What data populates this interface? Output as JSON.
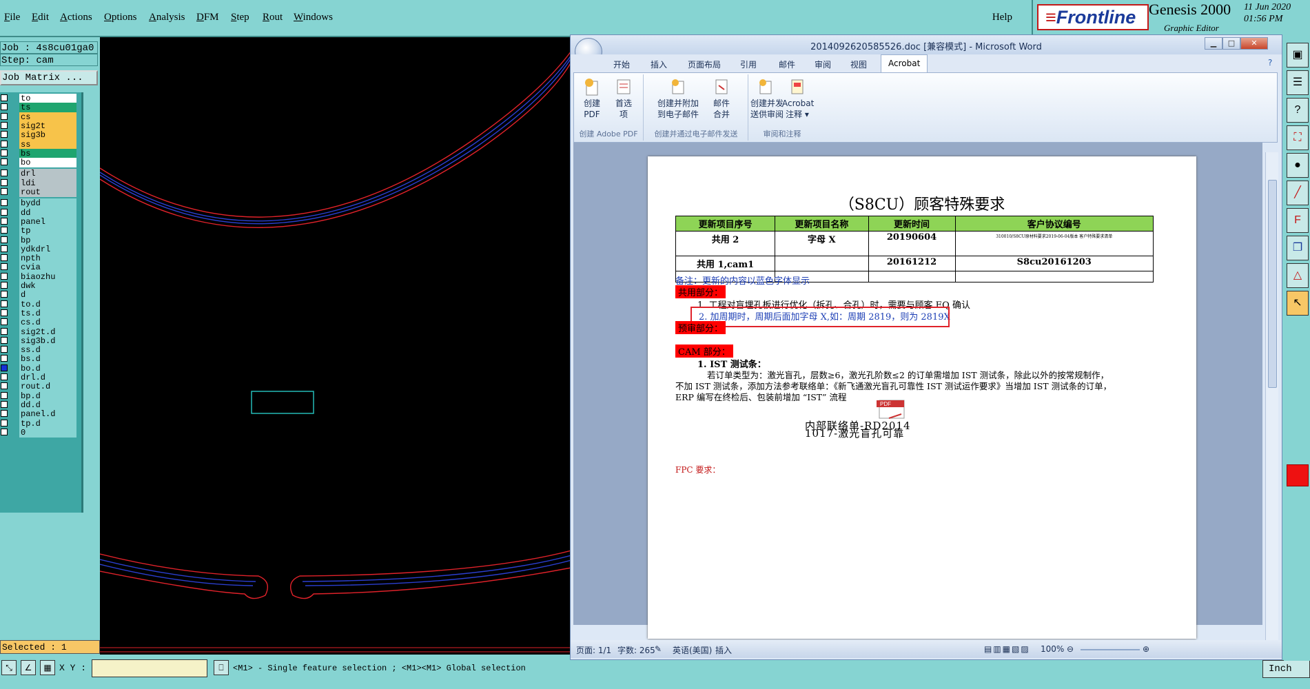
{
  "menubar": {
    "items": [
      "File",
      "Edit",
      "Actions",
      "Options",
      "Analysis",
      "DFM",
      "Step",
      "Rout",
      "Windows"
    ],
    "help": "Help"
  },
  "brand": {
    "logo": "Frontline",
    "name": "Genesis 2000",
    "subtitle": "Graphic Editor",
    "date": "11 Jun 2020",
    "time": "01:56 PM"
  },
  "left_panel": {
    "job": "Job : 4s8cu01ga0",
    "step": "Step: cam",
    "matrix_button": "Job Matrix ...",
    "layers": [
      {
        "name": "to",
        "color": "#ffffff"
      },
      {
        "name": "ts",
        "color": "#1fa56f"
      },
      {
        "name": "cs",
        "color": "#f7c34a"
      },
      {
        "name": "sig2t",
        "color": "#f7c34a"
      },
      {
        "name": "sig3b",
        "color": "#f7c34a"
      },
      {
        "name": "ss",
        "color": "#f7c34a"
      },
      {
        "name": "bs",
        "color": "#1fa56f"
      },
      {
        "name": "bo",
        "color": "#ffffff"
      },
      {
        "name": "drl",
        "color": "#b7c4c8"
      },
      {
        "name": "ldi",
        "color": "#b7c4c8"
      },
      {
        "name": "rout",
        "color": "#b7c4c8"
      },
      {
        "name": "bydd",
        "color": "#86d4d2"
      },
      {
        "name": "dd",
        "color": "#86d4d2"
      },
      {
        "name": "panel",
        "color": "#86d4d2"
      },
      {
        "name": "tp",
        "color": "#86d4d2"
      },
      {
        "name": "bp",
        "color": "#86d4d2"
      },
      {
        "name": "ydkdrl",
        "color": "#86d4d2"
      },
      {
        "name": "npth",
        "color": "#86d4d2"
      },
      {
        "name": "cvia",
        "color": "#86d4d2"
      },
      {
        "name": "biaozhu",
        "color": "#86d4d2"
      },
      {
        "name": "dwk",
        "color": "#86d4d2"
      },
      {
        "name": "d",
        "color": "#86d4d2"
      },
      {
        "name": "to.d",
        "color": "#86d4d2"
      },
      {
        "name": "ts.d",
        "color": "#86d4d2"
      },
      {
        "name": "cs.d",
        "color": "#86d4d2"
      },
      {
        "name": "sig2t.d",
        "color": "#86d4d2"
      },
      {
        "name": "sig3b.d",
        "color": "#86d4d2"
      },
      {
        "name": "ss.d",
        "color": "#86d4d2"
      },
      {
        "name": "bs.d",
        "color": "#86d4d2"
      },
      {
        "name": "bo.d",
        "color": "#86d4d2"
      },
      {
        "name": "drl.d",
        "color": "#86d4d2"
      },
      {
        "name": "rout.d",
        "color": "#86d4d2"
      },
      {
        "name": "bp.d",
        "color": "#86d4d2"
      },
      {
        "name": "dd.d",
        "color": "#86d4d2"
      },
      {
        "name": "panel.d",
        "color": "#86d4d2"
      },
      {
        "name": "tp.d",
        "color": "#86d4d2"
      },
      {
        "name": "0",
        "color": "#86d4d2"
      }
    ],
    "selected": "Selected : 1"
  },
  "bottom": {
    "xy_label": "X Y :",
    "xy_value": "",
    "hint": "<M1> - Single feature selection ; <M1><M1> Global selection",
    "unit": "Inch"
  },
  "word": {
    "title": "2014092620585526.doc [兼容模式] - Microsoft Word",
    "tabs": [
      "开始",
      "插入",
      "页面布局",
      "引用",
      "邮件",
      "审阅",
      "视图"
    ],
    "active_tab": "Acrobat",
    "ribbon": {
      "groups": [
        {
          "label": "创建 Adobe PDF",
          "buttons": [
            "创建\nPDF",
            "首选\n项"
          ]
        },
        {
          "label": "创建并通过电子邮件发送",
          "buttons": [
            "创建并附加\n到电子邮件",
            "邮件\n合并"
          ]
        },
        {
          "label": "审阅和注释",
          "buttons": [
            "创建并发\n送供审阅",
            "Acrobat\n注释 ▾"
          ]
        }
      ]
    },
    "doc": {
      "title": "（S8CU）顾客特殊要求",
      "table_headers": [
        "更新项目序号",
        "更新项目名称",
        "更新时间",
        "客户协议编号"
      ],
      "table_rows": [
        [
          "共用 2",
          "字母 X",
          "20190604",
          "310010/S8CU原材料要求2019-06-04版本  客户特殊要求清单"
        ],
        [
          "共用 1,cam1",
          "",
          "20161212",
          "S8cu20161203"
        ],
        [
          "",
          "",
          "",
          ""
        ]
      ],
      "note": "备注：更新的内容以蓝色字体显示",
      "section_common": "共用部分：",
      "item1": "1.  工程对盲埋孔板进行优化（拆孔、合孔）时，需要与顾客 EQ 确认",
      "item2": "2.  加周期时，周期后面加字母 X,如：周期 2819，则为 2819X",
      "section_pre": "预审部分：",
      "section_cam": "CAM 部分：",
      "cam_item_title": "1. IST 测试条：",
      "cam_para1": "若订单类型为：激光盲孔，层数≥6，激光孔阶数≤2 的订单需增加 IST 测试条，除此以外的按常规制作，",
      "cam_para2": "不加 IST 测试条，添加方法参考联络单：《新飞通激光盲孔可靠性 IST 测试运作要求》当增加 IST 测试条的订单，",
      "cam_para3": "ERP 编写在终检后、包装前增加 “IST” 流程",
      "attachment_line1": "内部联络单-RD2014",
      "attachment_line2": "1017-激光盲孔可靠",
      "fpc": "FPC 要求："
    },
    "status": {
      "page": "页面: 1/1",
      "words": "字数: 265",
      "lang": "英语(美国)",
      "mode": "插入",
      "zoom": "100%"
    }
  }
}
